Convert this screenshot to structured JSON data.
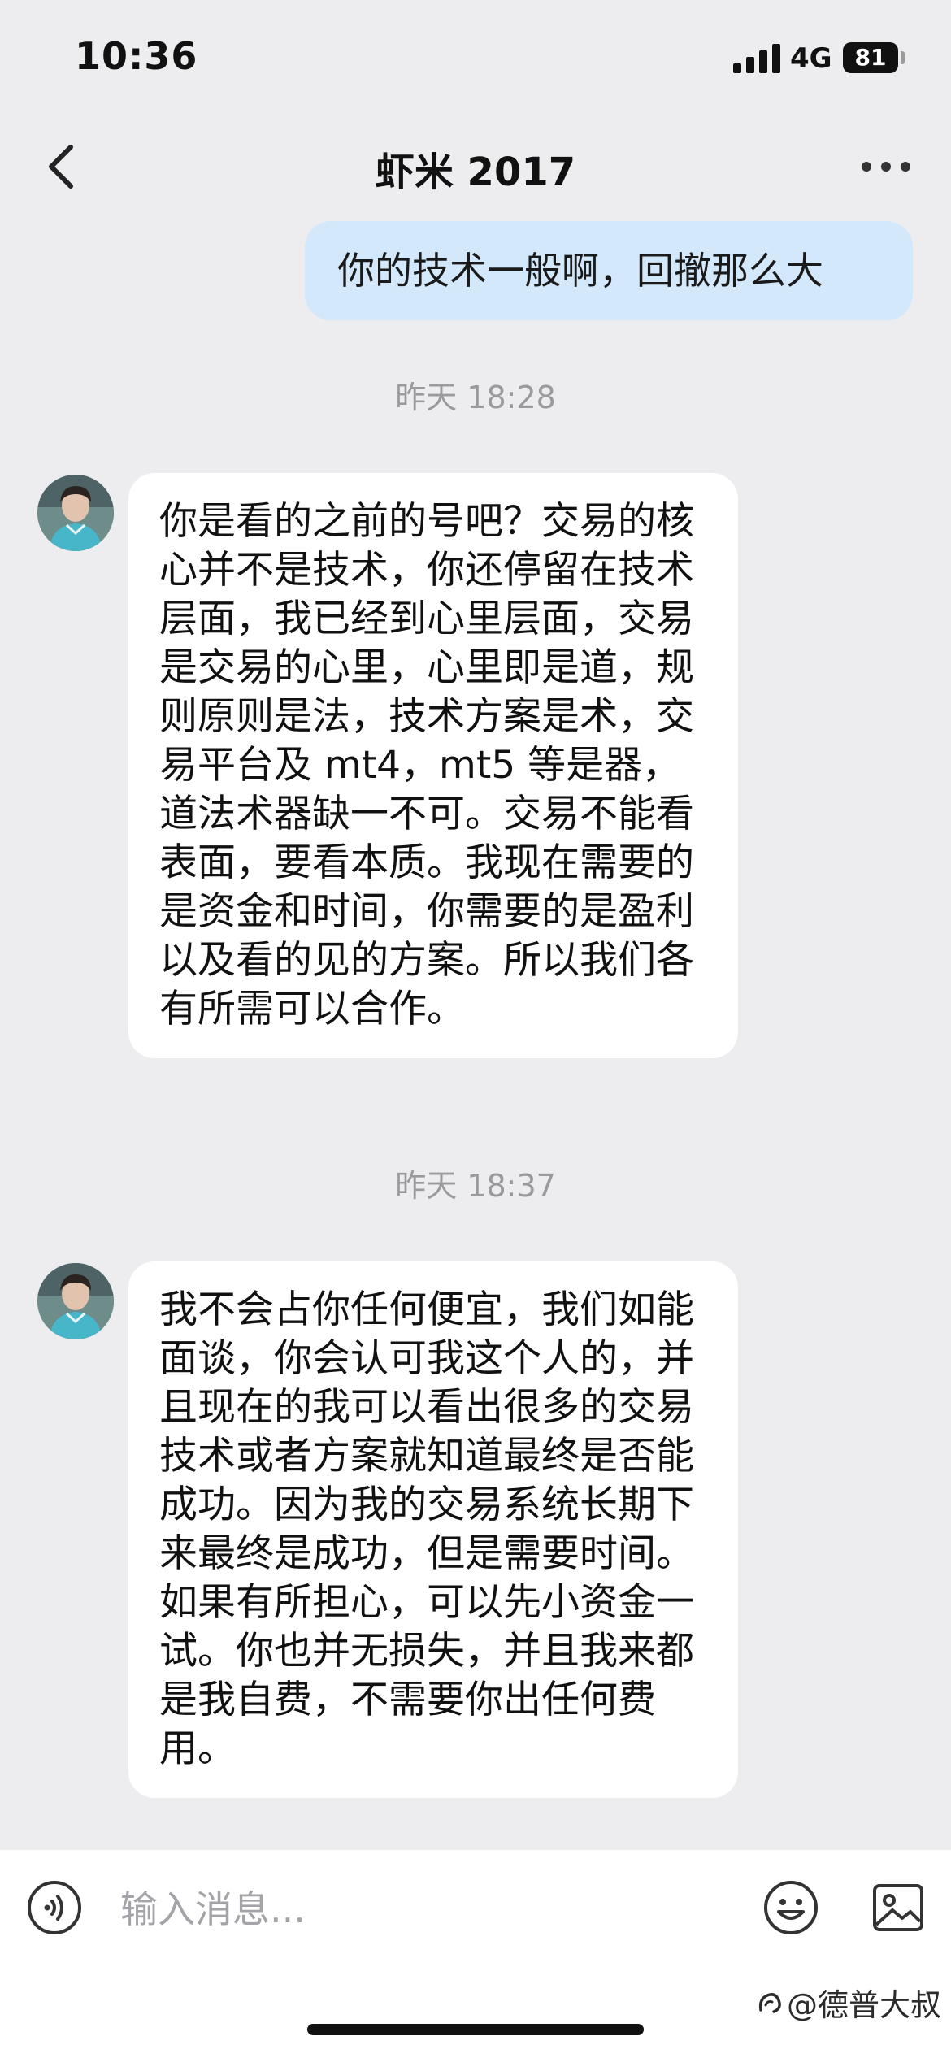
{
  "status_bar": {
    "time": "10:36",
    "network": "4G",
    "battery": "81"
  },
  "header": {
    "title": "虾米 2017"
  },
  "messages": [
    {
      "direction": "outgoing",
      "text": "你的技术一般啊，回撤那么大"
    },
    {
      "direction": "timestamp",
      "text": "昨天 18:28"
    },
    {
      "direction": "incoming",
      "text": "你是看的之前的号吧？交易的核心并不是技术，你还停留在技术层面，我已经到心里层面，交易是交易的心里，心里即是道，规则原则是法，技术方案是术，交易平台及 mt4，mt5 等是器，道法术器缺一不可。交易不能看表面，要看本质。我现在需要的是资金和时间，你需要的是盈利以及看的见的方案。所以我们各有所需可以合作。"
    },
    {
      "direction": "timestamp",
      "text": "昨天 18:37"
    },
    {
      "direction": "incoming",
      "text": "我不会占你任何便宜，我们如能面谈，你会认可我这个人的，并且现在的我可以看出很多的交易技术或者方案就知道最终是否能成功。因为我的交易系统长期下来最终是成功，但是需要时间。如果有所担心，可以先小资金一试。你也并无损失，并且我来都是我自费，不需要你出任何费用。"
    }
  ],
  "input_bar": {
    "placeholder": "输入消息..."
  },
  "watermark": {
    "text": "@德普大叔"
  }
}
